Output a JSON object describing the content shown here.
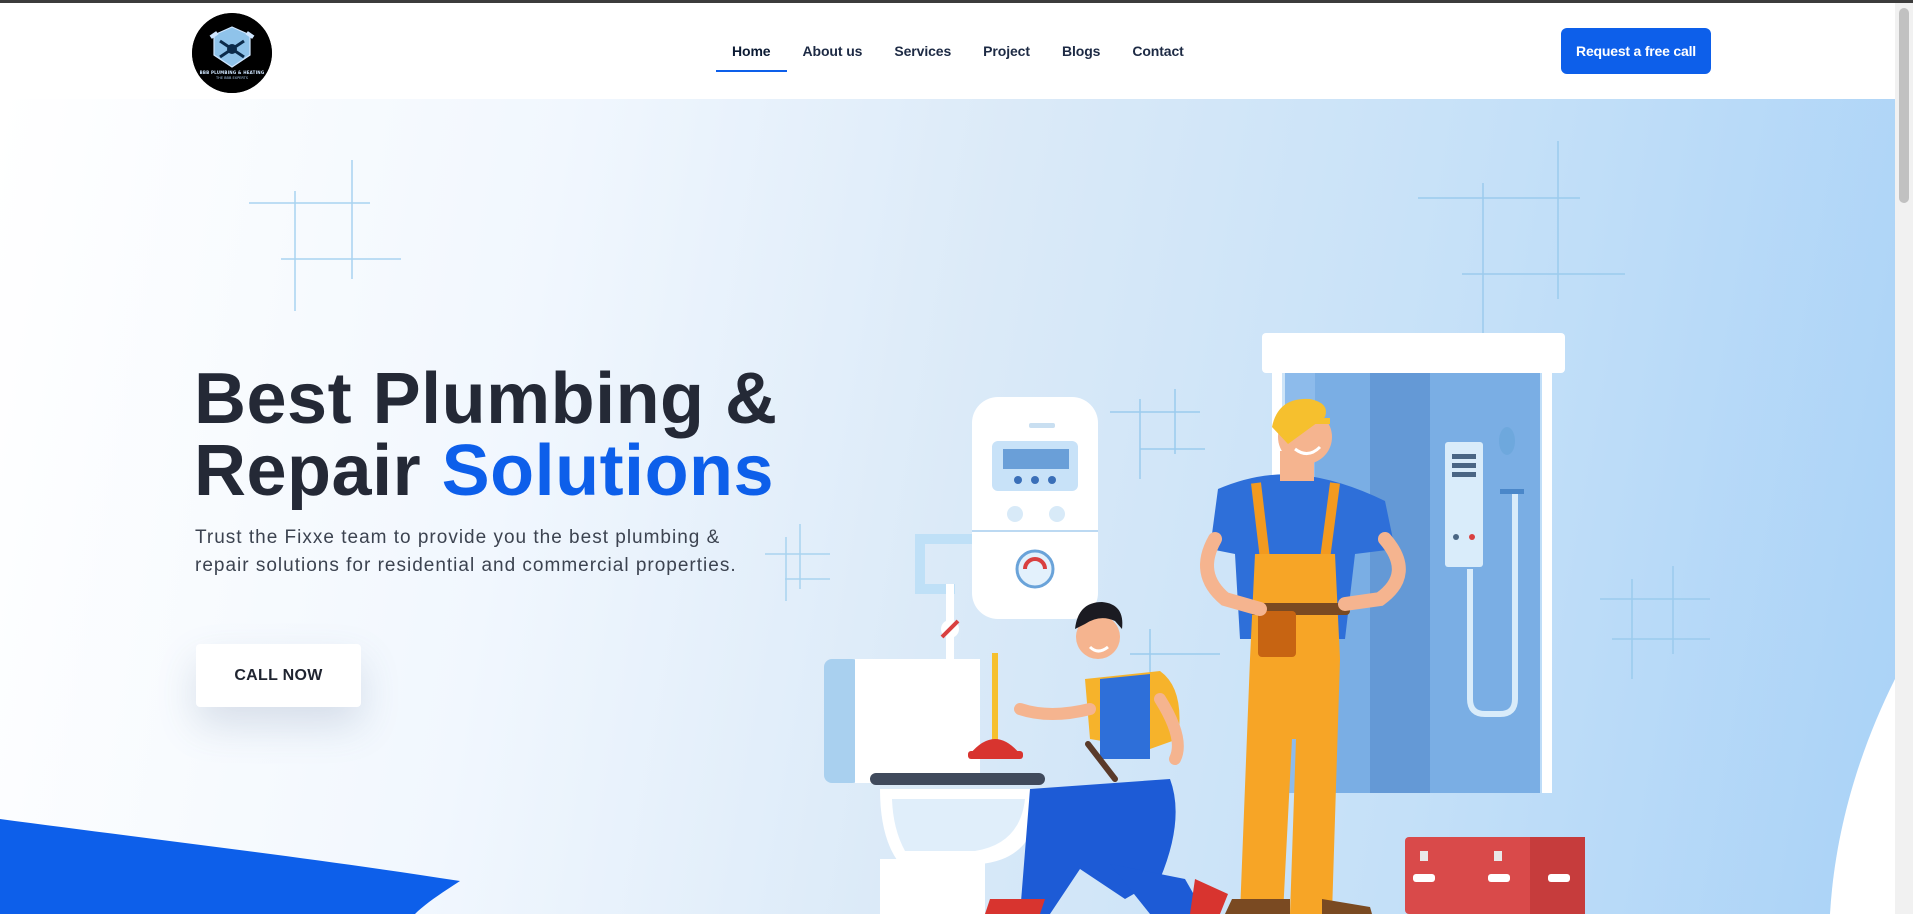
{
  "brand": {
    "logo_text": "BBB PLUMBING & HEATING",
    "logo_subtext": "THE BBB EXPERTS"
  },
  "nav": {
    "items": [
      {
        "label": "Home",
        "active": true
      },
      {
        "label": "About us",
        "active": false
      },
      {
        "label": "Services",
        "active": false
      },
      {
        "label": "Project",
        "active": false
      },
      {
        "label": "Blogs",
        "active": false
      },
      {
        "label": "Contact",
        "active": false
      }
    ],
    "cta_label": "Request a free call"
  },
  "hero": {
    "title_line1": "Best Plumbing &",
    "title_line2_plain": "Repair ",
    "title_line2_accent": "Solutions",
    "subtitle": "Trust the Fixxe team to provide you the best plumbing & repair solutions for residential and commercial properties.",
    "call_label": "CALL NOW"
  },
  "colors": {
    "accent": "#0d5fea",
    "heading": "#242936",
    "hero_bg_light": "#f1f7fe",
    "hero_bg_dark": "#a9d2f7"
  },
  "icons": {
    "logo": "plumbing-crest-icon",
    "illustration": "plumbers-bathroom-illustration"
  }
}
